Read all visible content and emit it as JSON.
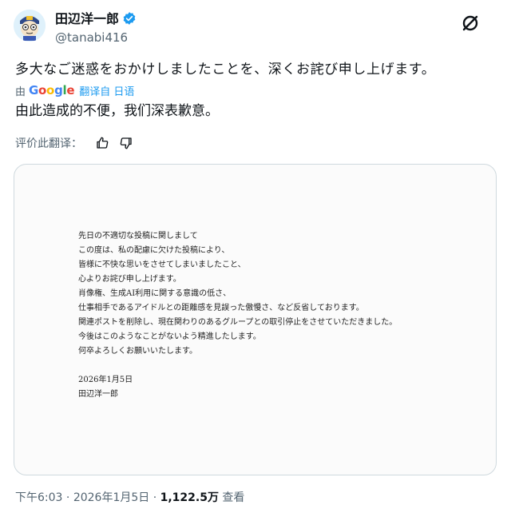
{
  "author": {
    "name": "田辺洋一郎",
    "handle": "@tanabi416"
  },
  "tweet": {
    "text": "多大なご迷惑をおかけしましたことを、深くお詫び申し上げます。",
    "translation_prefix": "由",
    "translation_provider": "Google",
    "translation_label": "翻译自 日语",
    "translated_text": "由此造成的不便，我们深表歉意。",
    "rate_label": "评价此翻译："
  },
  "letter": {
    "lines": [
      "先日の不適切な投稿に関しまして",
      "この度は、私の配慮に欠けた投稿により、",
      "皆様に不快な思いをさせてしまいましたこと、",
      "心よりお詫び申し上げます。",
      "肖像権、生成AI利用に関する意識の低さ、",
      "仕事相手であるアイドルとの距離感を見誤った傲慢さ、など反省しております。",
      "関連ポストを削除し、現在関わりのあるグループとの取引停止をさせていただきました。",
      "今後はこのようなことがないよう精進したします。",
      "何卒よろしくお願いいたします。"
    ],
    "date": "2026年1月5日",
    "signature": "田辺洋一郎"
  },
  "footer": {
    "time": "下午6:03",
    "separator": "·",
    "date": "2026年1月5日",
    "separator2": "·",
    "views_count": "1,122.5万",
    "views_label": "查看"
  },
  "icons": {
    "verified": "verified-badge-icon",
    "grok": "grok-icon",
    "like": "thumbs-up-icon",
    "dislike": "thumbs-down-icon"
  },
  "colors": {
    "verified": "#1d9bf0",
    "link": "#1d9bf0",
    "secondary_text": "#536471"
  }
}
